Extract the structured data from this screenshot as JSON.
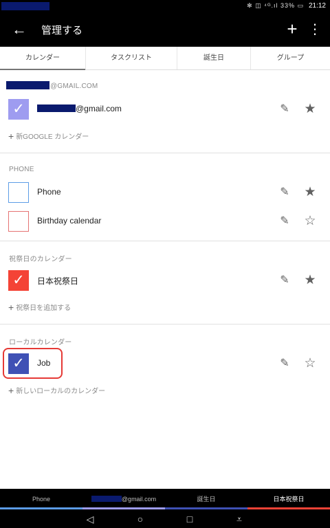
{
  "status_bar": {
    "icons_text": "✻ ◫ ⁴ᴳ.ıl 33% ▭",
    "time": "21:12"
  },
  "app_bar": {
    "back_glyph": "←",
    "title": "管理する",
    "add_glyph": "+",
    "more_glyph": "⋮"
  },
  "tabs": [
    {
      "label": "カレンダー",
      "active": true
    },
    {
      "label": "タスクリスト",
      "active": false
    },
    {
      "label": "誕生日",
      "active": false
    },
    {
      "label": "グループ",
      "active": false
    }
  ],
  "google_section": {
    "header_suffix": "@GMAIL.COM",
    "account_suffix": "@gmail.com",
    "add_label": "新GOOGLE カレンダー"
  },
  "phone_section": {
    "header": "PHONE",
    "items": [
      {
        "name": "Phone",
        "checked": false,
        "color": "#5c9ce6",
        "starred": true
      },
      {
        "name": "Birthday calendar",
        "checked": false,
        "color": "#e57373",
        "starred": false
      }
    ]
  },
  "holiday_section": {
    "header": "祝祭日のカレンダー",
    "item_name": "日本祝祭日",
    "add_label": "祝祭日を追加する"
  },
  "local_section": {
    "header": "ローカルカレンダー",
    "item_name": "Job",
    "add_label": "新しいローカルのカレンダー"
  },
  "icons": {
    "check": "✓",
    "edit": "✎",
    "star_filled": "★",
    "star_outline": "☆",
    "plus": "+"
  },
  "colors": {
    "google_account": "#9e9cf0",
    "phone": "#5c9ce6",
    "birthday": "#e57373",
    "holiday": "#f44336",
    "local_job": "#3f51b5",
    "highlight": "#e53935"
  },
  "bottom_tabs": [
    {
      "label": "Phone",
      "color": "#5c9ce6"
    },
    {
      "label": "@gmail.com",
      "color": "#9e9cf0"
    },
    {
      "label": "誕生日",
      "color": "#3f51b5"
    },
    {
      "label": "日本祝祭日",
      "color": "#f44336"
    }
  ],
  "nav_bar": {
    "back": "◁",
    "home": "○",
    "recents": "□",
    "menu": "⩡"
  }
}
